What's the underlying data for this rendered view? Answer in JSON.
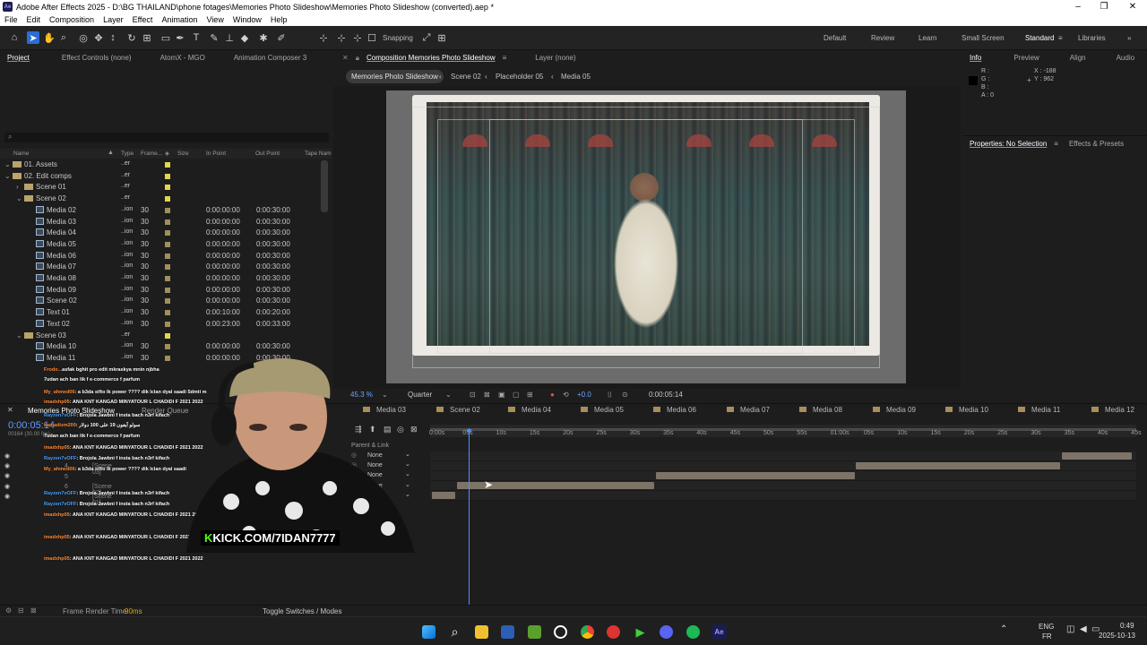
{
  "window": {
    "title": "Adobe After Effects 2025 - D:\\BG THAILAND\\phone fotages\\Memories Photo Slideshow\\Memories Photo Slideshow (converted).aep *",
    "logo": "Ae"
  },
  "menu": [
    "File",
    "Edit",
    "Composition",
    "Layer",
    "Effect",
    "Animation",
    "View",
    "Window",
    "Help"
  ],
  "toolbar": {
    "snapping": "Snapping",
    "workspaces": [
      "Default",
      "Review",
      "Learn",
      "Small Screen",
      "Standard",
      "Libraries"
    ],
    "active_workspace": "Standard"
  },
  "project_panel": {
    "tabs": [
      "Project",
      "Effect Controls (none)",
      "AtomX - MGO",
      "Animation Composer 3"
    ],
    "search_placeholder": "",
    "columns": [
      "Name",
      "Type",
      "Frame...",
      "Size",
      "In Point",
      "Out Point",
      "Tape Nam"
    ],
    "rows": [
      {
        "name": "01. Assets",
        "type": "..er",
        "fr": "",
        "in": "",
        "out": "",
        "kind": "folder",
        "indent": 0
      },
      {
        "name": "02. Edit comps",
        "type": "..er",
        "fr": "",
        "in": "",
        "out": "",
        "kind": "folder",
        "indent": 0
      },
      {
        "name": "Scene 01",
        "type": "..er",
        "fr": "",
        "in": "",
        "out": "",
        "kind": "folder",
        "indent": 1
      },
      {
        "name": "Scene 02",
        "type": "..er",
        "fr": "",
        "in": "",
        "out": "",
        "kind": "folder",
        "indent": 1
      },
      {
        "name": "Media 02",
        "type": "..ion",
        "fr": "30",
        "in": "0:00:00:00",
        "out": "0:00:30:00",
        "kind": "comp",
        "indent": 2
      },
      {
        "name": "Media 03",
        "type": "..ion",
        "fr": "30",
        "in": "0:00:00:00",
        "out": "0:00:30:00",
        "kind": "comp",
        "indent": 2
      },
      {
        "name": "Media 04",
        "type": "..ion",
        "fr": "30",
        "in": "0:00:00:00",
        "out": "0:00:30:00",
        "kind": "comp",
        "indent": 2
      },
      {
        "name": "Media 05",
        "type": "..ion",
        "fr": "30",
        "in": "0:00:00:00",
        "out": "0:00:30:00",
        "kind": "comp",
        "indent": 2
      },
      {
        "name": "Media 06",
        "type": "..ion",
        "fr": "30",
        "in": "0:00:00:00",
        "out": "0:00:30:00",
        "kind": "comp",
        "indent": 2
      },
      {
        "name": "Media 07",
        "type": "..ion",
        "fr": "30",
        "in": "0:00:00:00",
        "out": "0:00:30:00",
        "kind": "comp",
        "indent": 2
      },
      {
        "name": "Media 08",
        "type": "..ion",
        "fr": "30",
        "in": "0:00:00:00",
        "out": "0:00:30:00",
        "kind": "comp",
        "indent": 2
      },
      {
        "name": "Media 09",
        "type": "..ion",
        "fr": "30",
        "in": "0:00:00:00",
        "out": "0:00:30:00",
        "kind": "comp",
        "indent": 2
      },
      {
        "name": "Scene 02",
        "type": "..ion",
        "fr": "30",
        "in": "0:00:00:00",
        "out": "0:00:30:00",
        "kind": "comp",
        "indent": 2
      },
      {
        "name": "Text 01",
        "type": "..ion",
        "fr": "30",
        "in": "0:00:10:00",
        "out": "0:00:20:00",
        "kind": "comp",
        "indent": 2
      },
      {
        "name": "Text 02",
        "type": "..ion",
        "fr": "30",
        "in": "0:00:23:00",
        "out": "0:00:33:00",
        "kind": "comp",
        "indent": 2
      },
      {
        "name": "Scene 03",
        "type": "..er",
        "fr": "",
        "in": "",
        "out": "",
        "kind": "folder",
        "indent": 1
      },
      {
        "name": "Media 10",
        "type": "..ion",
        "fr": "30",
        "in": "0:00:00:00",
        "out": "0:00:30:00",
        "kind": "comp",
        "indent": 2
      },
      {
        "name": "Media 11",
        "type": "..ion",
        "fr": "30",
        "in": "0:00:00:00",
        "out": "0:00:30:00",
        "kind": "comp",
        "indent": 2
      }
    ]
  },
  "composition": {
    "tab": "Composition Memories Photo Slideshow",
    "layer_tab": "Layer (none)",
    "breadcrumbs": [
      "Memories Photo Slideshow",
      "Scene 02",
      "Placeholder 05",
      "Media 05"
    ],
    "zoom": "45.3 %",
    "resolution": "Quarter",
    "exposure": "+0.0",
    "timecode": "0:00:05:14"
  },
  "info_panel": {
    "tabs": [
      "Info",
      "Preview",
      "Align",
      "Audio"
    ],
    "r": "R :",
    "g": "G :",
    "b": "B :",
    "a": "A : 0",
    "x": "X : -188",
    "y": "Y : 962"
  },
  "properties_panel": {
    "tabs": [
      "Properties: No Selection",
      "Effects & Presets"
    ]
  },
  "timeline": {
    "comp_name": "Memories Photo Slideshow",
    "render_queue": "Render Queue",
    "timecode": "0:00:05:14",
    "frames": "00164 (30.00 fps)",
    "comp_tabs": [
      "Media 03",
      "Scene 02",
      "Media 04",
      "Media 05",
      "Media 06",
      "Media 07",
      "Media 08",
      "Media 09",
      "Media 10",
      "Media 11",
      "Media 12"
    ],
    "ruler": [
      "0:00s",
      "05s",
      "10s",
      "15s",
      "20s",
      "25s",
      "30s",
      "35s",
      "40s",
      "45s",
      "50s",
      "55s",
      "01:00s",
      "05s",
      "10s",
      "15s",
      "20s",
      "25s",
      "30s",
      "35s",
      "40s",
      "45s"
    ],
    "parent_header": "Parent & Link",
    "parent_values": [
      "None",
      "None",
      "None",
      "None",
      "None"
    ],
    "layers": [
      "[Scene 03]",
      "[Scene 02]",
      "[Scene 01]"
    ],
    "layer_numbers": [
      "4",
      "5",
      "6"
    ],
    "frame_render_time_label": "Frame Render Time:",
    "frame_render_time": "90ms",
    "toggle_label": "Toggle Switches / Modes"
  },
  "stream_overlay": {
    "kick": "KICK.COM/7IDAN7777",
    "chat": [
      {
        "user": "Frodo...",
        "msg": "asfak bghit pro edit mkraskya mnin njbha"
      },
      {
        "user": "",
        "msg": "7udan ach ban lik f e-commerce f parfum"
      },
      {
        "user": "My_ahmed06",
        "msg": ": a b3da sifto lk power ???? dik lclan dyal saadi 5dmti m"
      },
      {
        "user": "imadxhp05",
        "msg": ": ANA KNT KANGAD MINYATOUR L CHADIDI F 2021 2022"
      },
      {
        "user": "Rayzen7vOFF",
        "msg": ": Brojola Jawbni f insta bach n3rf kifach"
      },
      {
        "user": "kamadizm200",
        "msg": ": سولو آيفون 19 على 100 دولار"
      },
      {
        "user": "",
        "msg": "7udan ach ban lik f e-commerce f parfum"
      },
      {
        "user": "imadxhp05",
        "msg": ": ANA KNT KANGAD MINYATOUR L CHADIDI F 2021 2022"
      },
      {
        "user": "Rayzen7vOFF",
        "msg": ": Brojola Jawbni f insta bach n3rf kifach"
      },
      {
        "user": "My_ahmed06",
        "msg": ": a b3da sifto lk power ???? dik lclan dyal saadi"
      },
      {
        "user": "Rayzen7vOFF",
        "msg": ": Brojola Jawbni f insta bach n3rf kifach"
      },
      {
        "user": "Rayzen7vOFF",
        "msg": ": Brojola Jawbni f insta bach n3rf kifach"
      },
      {
        "user": "imadxhp05",
        "msg": ": ANA KNT KANGAD MINYATOUR L CHADIDI F 2021 2022"
      },
      {
        "user": "imadxhp05",
        "msg": ": ANA KNT KANGAD MINYATOUR L CHADIDI F 2021 2022"
      },
      {
        "user": "imadxhp05",
        "msg": ": ANA KNT KANGAD MINYATOUR L CHADIDI F 2021 2022"
      }
    ]
  },
  "taskbar": {
    "lang": "ENG",
    "region": "FR",
    "time": "0:49",
    "date": "2025-10-13"
  },
  "colors": {
    "accent": "#2c6dd3",
    "playhead": "#4a90ff",
    "label_yellow": "#e3d54b",
    "bar": "#7d7467"
  }
}
